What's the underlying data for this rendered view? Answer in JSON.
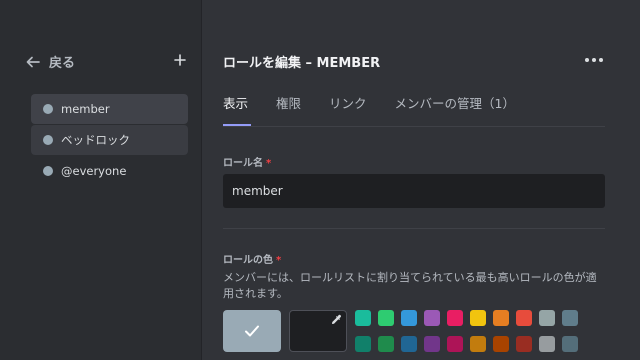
{
  "sidebar": {
    "back_label": "戻る",
    "roles": [
      {
        "label": "member",
        "color": "#99aab5"
      },
      {
        "label": "ベッドロック",
        "color": "#99aab5"
      },
      {
        "label": "@everyone",
        "color": "#99aab5"
      }
    ]
  },
  "header": {
    "title": "ロールを編集 – MEMBER"
  },
  "tabs": [
    {
      "label": "表示",
      "active": true
    },
    {
      "label": "権限",
      "active": false
    },
    {
      "label": "リンク",
      "active": false
    },
    {
      "label": "メンバーの管理（1）",
      "active": false
    }
  ],
  "form": {
    "role_name_label": "ロール名",
    "required_mark": "*",
    "role_name_value": "member",
    "role_color_label": "ロールの色",
    "role_color_description": "メンバーには、ロールリストに割り当てられている最も高いロールの色が適用されます。",
    "default_color": "#99aab5"
  },
  "palette": {
    "row1": [
      "#1abc9c",
      "#2ecc71",
      "#3498db",
      "#9b59b6",
      "#e91e63",
      "#f1c40f",
      "#e67e22",
      "#e74c3c",
      "#95a5a6",
      "#607d8b"
    ],
    "row2": [
      "#11806a",
      "#1f8b4c",
      "#206694",
      "#71368a",
      "#ad1457",
      "#c27c0e",
      "#a84300",
      "#992d22",
      "#979c9f",
      "#546e7a"
    ]
  }
}
